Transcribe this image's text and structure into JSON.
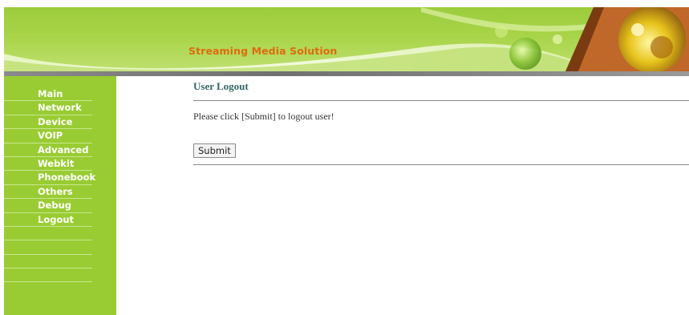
{
  "header": {
    "title": "Streaming Media Solution",
    "colors": {
      "banner_green": "#9ccc3c",
      "title_orange": "#e06a10"
    }
  },
  "sidebar": {
    "color": "#99cc33",
    "items": [
      {
        "label": "Main"
      },
      {
        "label": "Network"
      },
      {
        "label": "Device"
      },
      {
        "label": "VOIP"
      },
      {
        "label": "Advanced"
      },
      {
        "label": "Webkit"
      },
      {
        "label": "Phonebook"
      },
      {
        "label": "Others"
      },
      {
        "label": "Debug"
      },
      {
        "label": "Logout"
      }
    ]
  },
  "main": {
    "heading": "User Logout",
    "message": "Please click [Submit] to logout user!",
    "submit_label": "Submit"
  }
}
